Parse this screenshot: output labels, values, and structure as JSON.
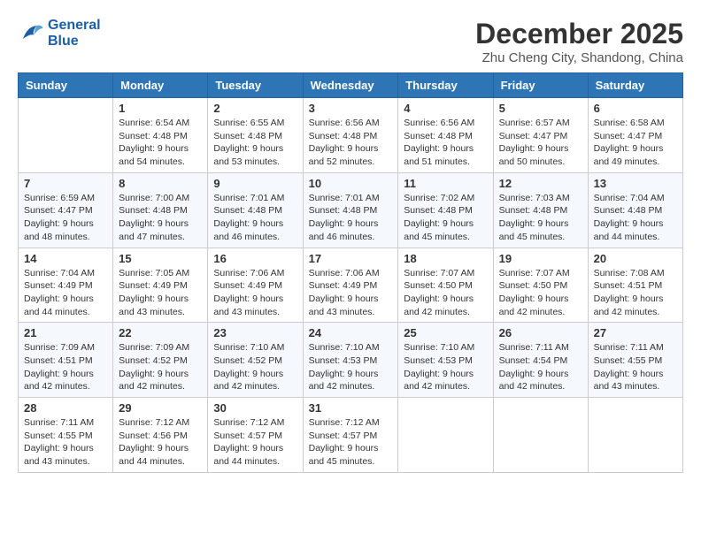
{
  "logo": {
    "line1": "General",
    "line2": "Blue"
  },
  "title": "December 2025",
  "subtitle": "Zhu Cheng City, Shandong, China",
  "weekdays": [
    "Sunday",
    "Monday",
    "Tuesday",
    "Wednesday",
    "Thursday",
    "Friday",
    "Saturday"
  ],
  "weeks": [
    [
      {
        "day": "",
        "sunrise": "",
        "sunset": "",
        "daylight": ""
      },
      {
        "day": "1",
        "sunrise": "Sunrise: 6:54 AM",
        "sunset": "Sunset: 4:48 PM",
        "daylight": "Daylight: 9 hours and 54 minutes."
      },
      {
        "day": "2",
        "sunrise": "Sunrise: 6:55 AM",
        "sunset": "Sunset: 4:48 PM",
        "daylight": "Daylight: 9 hours and 53 minutes."
      },
      {
        "day": "3",
        "sunrise": "Sunrise: 6:56 AM",
        "sunset": "Sunset: 4:48 PM",
        "daylight": "Daylight: 9 hours and 52 minutes."
      },
      {
        "day": "4",
        "sunrise": "Sunrise: 6:56 AM",
        "sunset": "Sunset: 4:48 PM",
        "daylight": "Daylight: 9 hours and 51 minutes."
      },
      {
        "day": "5",
        "sunrise": "Sunrise: 6:57 AM",
        "sunset": "Sunset: 4:47 PM",
        "daylight": "Daylight: 9 hours and 50 minutes."
      },
      {
        "day": "6",
        "sunrise": "Sunrise: 6:58 AM",
        "sunset": "Sunset: 4:47 PM",
        "daylight": "Daylight: 9 hours and 49 minutes."
      }
    ],
    [
      {
        "day": "7",
        "sunrise": "Sunrise: 6:59 AM",
        "sunset": "Sunset: 4:47 PM",
        "daylight": "Daylight: 9 hours and 48 minutes."
      },
      {
        "day": "8",
        "sunrise": "Sunrise: 7:00 AM",
        "sunset": "Sunset: 4:48 PM",
        "daylight": "Daylight: 9 hours and 47 minutes."
      },
      {
        "day": "9",
        "sunrise": "Sunrise: 7:01 AM",
        "sunset": "Sunset: 4:48 PM",
        "daylight": "Daylight: 9 hours and 46 minutes."
      },
      {
        "day": "10",
        "sunrise": "Sunrise: 7:01 AM",
        "sunset": "Sunset: 4:48 PM",
        "daylight": "Daylight: 9 hours and 46 minutes."
      },
      {
        "day": "11",
        "sunrise": "Sunrise: 7:02 AM",
        "sunset": "Sunset: 4:48 PM",
        "daylight": "Daylight: 9 hours and 45 minutes."
      },
      {
        "day": "12",
        "sunrise": "Sunrise: 7:03 AM",
        "sunset": "Sunset: 4:48 PM",
        "daylight": "Daylight: 9 hours and 45 minutes."
      },
      {
        "day": "13",
        "sunrise": "Sunrise: 7:04 AM",
        "sunset": "Sunset: 4:48 PM",
        "daylight": "Daylight: 9 hours and 44 minutes."
      }
    ],
    [
      {
        "day": "14",
        "sunrise": "Sunrise: 7:04 AM",
        "sunset": "Sunset: 4:49 PM",
        "daylight": "Daylight: 9 hours and 44 minutes."
      },
      {
        "day": "15",
        "sunrise": "Sunrise: 7:05 AM",
        "sunset": "Sunset: 4:49 PM",
        "daylight": "Daylight: 9 hours and 43 minutes."
      },
      {
        "day": "16",
        "sunrise": "Sunrise: 7:06 AM",
        "sunset": "Sunset: 4:49 PM",
        "daylight": "Daylight: 9 hours and 43 minutes."
      },
      {
        "day": "17",
        "sunrise": "Sunrise: 7:06 AM",
        "sunset": "Sunset: 4:49 PM",
        "daylight": "Daylight: 9 hours and 43 minutes."
      },
      {
        "day": "18",
        "sunrise": "Sunrise: 7:07 AM",
        "sunset": "Sunset: 4:50 PM",
        "daylight": "Daylight: 9 hours and 42 minutes."
      },
      {
        "day": "19",
        "sunrise": "Sunrise: 7:07 AM",
        "sunset": "Sunset: 4:50 PM",
        "daylight": "Daylight: 9 hours and 42 minutes."
      },
      {
        "day": "20",
        "sunrise": "Sunrise: 7:08 AM",
        "sunset": "Sunset: 4:51 PM",
        "daylight": "Daylight: 9 hours and 42 minutes."
      }
    ],
    [
      {
        "day": "21",
        "sunrise": "Sunrise: 7:09 AM",
        "sunset": "Sunset: 4:51 PM",
        "daylight": "Daylight: 9 hours and 42 minutes."
      },
      {
        "day": "22",
        "sunrise": "Sunrise: 7:09 AM",
        "sunset": "Sunset: 4:52 PM",
        "daylight": "Daylight: 9 hours and 42 minutes."
      },
      {
        "day": "23",
        "sunrise": "Sunrise: 7:10 AM",
        "sunset": "Sunset: 4:52 PM",
        "daylight": "Daylight: 9 hours and 42 minutes."
      },
      {
        "day": "24",
        "sunrise": "Sunrise: 7:10 AM",
        "sunset": "Sunset: 4:53 PM",
        "daylight": "Daylight: 9 hours and 42 minutes."
      },
      {
        "day": "25",
        "sunrise": "Sunrise: 7:10 AM",
        "sunset": "Sunset: 4:53 PM",
        "daylight": "Daylight: 9 hours and 42 minutes."
      },
      {
        "day": "26",
        "sunrise": "Sunrise: 7:11 AM",
        "sunset": "Sunset: 4:54 PM",
        "daylight": "Daylight: 9 hours and 42 minutes."
      },
      {
        "day": "27",
        "sunrise": "Sunrise: 7:11 AM",
        "sunset": "Sunset: 4:55 PM",
        "daylight": "Daylight: 9 hours and 43 minutes."
      }
    ],
    [
      {
        "day": "28",
        "sunrise": "Sunrise: 7:11 AM",
        "sunset": "Sunset: 4:55 PM",
        "daylight": "Daylight: 9 hours and 43 minutes."
      },
      {
        "day": "29",
        "sunrise": "Sunrise: 7:12 AM",
        "sunset": "Sunset: 4:56 PM",
        "daylight": "Daylight: 9 hours and 44 minutes."
      },
      {
        "day": "30",
        "sunrise": "Sunrise: 7:12 AM",
        "sunset": "Sunset: 4:57 PM",
        "daylight": "Daylight: 9 hours and 44 minutes."
      },
      {
        "day": "31",
        "sunrise": "Sunrise: 7:12 AM",
        "sunset": "Sunset: 4:57 PM",
        "daylight": "Daylight: 9 hours and 45 minutes."
      },
      {
        "day": "",
        "sunrise": "",
        "sunset": "",
        "daylight": ""
      },
      {
        "day": "",
        "sunrise": "",
        "sunset": "",
        "daylight": ""
      },
      {
        "day": "",
        "sunrise": "",
        "sunset": "",
        "daylight": ""
      }
    ]
  ]
}
